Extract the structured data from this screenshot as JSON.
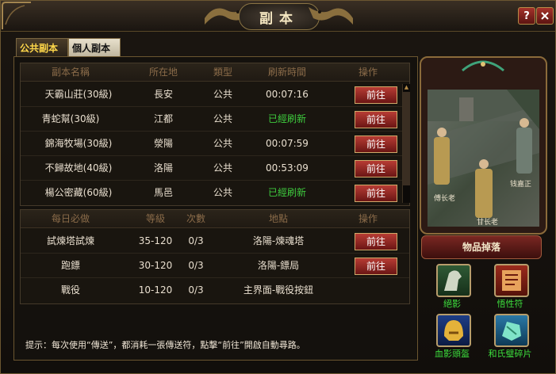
{
  "window": {
    "title": "副本"
  },
  "tabs": [
    {
      "label": "公共副本",
      "active": true
    },
    {
      "label": "個人副本",
      "active": false
    }
  ],
  "dungeons": {
    "headers": [
      "副本名稱",
      "所在地",
      "類型",
      "刷新時間",
      "操作"
    ],
    "rows": [
      {
        "name": "天霸山莊(30級)",
        "location": "長安",
        "type": "公共",
        "refresh": "00:07:16",
        "refreshed": false,
        "action": "前往"
      },
      {
        "name": "青蛇幫(30級)",
        "location": "江都",
        "type": "公共",
        "refresh": "已經刷新",
        "refreshed": true,
        "action": "前往"
      },
      {
        "name": "錦海牧場(30級)",
        "location": "滎陽",
        "type": "公共",
        "refresh": "00:07:59",
        "refreshed": false,
        "action": "前往"
      },
      {
        "name": "不歸故地(40級)",
        "location": "洛陽",
        "type": "公共",
        "refresh": "00:53:09",
        "refreshed": false,
        "action": "前往"
      },
      {
        "name": "楊公密藏(60級)",
        "location": "馬邑",
        "type": "公共",
        "refresh": "已經刷新",
        "refreshed": true,
        "action": "前往"
      }
    ]
  },
  "daily": {
    "headers": [
      "每日必做",
      "等級",
      "次數",
      "地點",
      "操作"
    ],
    "rows": [
      {
        "name": "試煉塔試煉",
        "level": "35-120",
        "count": "0/3",
        "place": "洛陽-煉魂塔",
        "action": "前往"
      },
      {
        "name": "跑鏢",
        "level": "30-120",
        "count": "0/3",
        "place": "洛陽-鏢局",
        "action": "前往"
      },
      {
        "name": "戰役",
        "level": "10-120",
        "count": "0/3",
        "place": "主界面-戰役按鈕",
        "action": ""
      }
    ]
  },
  "hint": "提示：每次使用“傳送”，都消耗一張傳送符，點擊“前往”開啟自動尋路。",
  "scene": {
    "npcs": [
      "傅长老",
      "钱嘉正",
      "甘长老"
    ]
  },
  "drops": {
    "label": "物品掉落",
    "items": [
      {
        "name": "絕影",
        "icon": "horse-icon"
      },
      {
        "name": "悟性符",
        "icon": "scroll-icon"
      },
      {
        "name": "血影頭盔",
        "icon": "helmet-icon"
      },
      {
        "name": "和氏璧碎片",
        "icon": "jade-icon"
      }
    ]
  },
  "colors": {
    "accent_gold": "#ffd84a",
    "green": "#3ecb3e",
    "button_red": "#b73c34"
  }
}
